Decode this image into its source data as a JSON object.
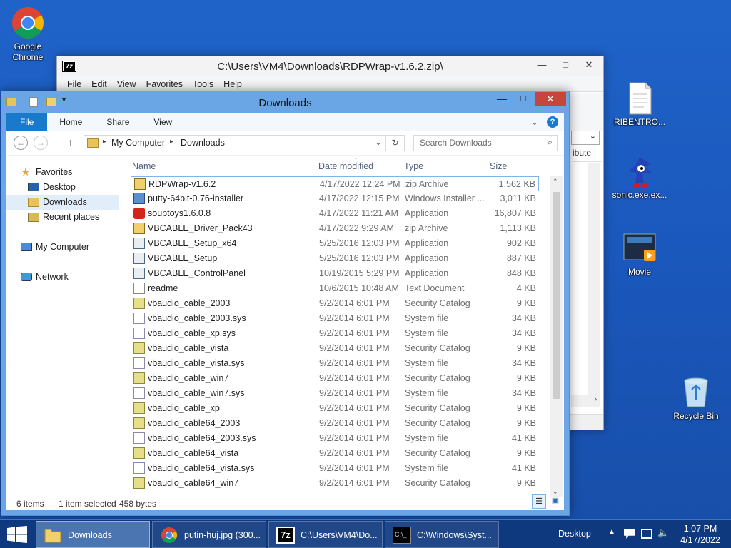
{
  "desktop": {
    "icons": [
      {
        "label": "Google\nChrome",
        "icon": "chrome-icon"
      },
      {
        "label": "RIBENTRO...",
        "icon": "document-icon"
      },
      {
        "label": "sonic.exe.ex...",
        "icon": "sonic-icon"
      },
      {
        "label": "Movie",
        "icon": "video-icon"
      },
      {
        "label": "Recycle Bin",
        "icon": "recycle-bin-icon"
      }
    ]
  },
  "sevenzip": {
    "title": "C:\\Users\\VM4\\Downloads\\RDPWrap-v1.6.2.zip\\",
    "badge": "7z",
    "menu": [
      "File",
      "Edit",
      "View",
      "Favorites",
      "Tools",
      "Help"
    ],
    "partial_column": "ibute"
  },
  "explorer": {
    "title": "Downloads",
    "ribbon_tabs": {
      "file": "File",
      "home": "Home",
      "share": "Share",
      "view": "View"
    },
    "breadcrumb": [
      "My Computer",
      "Downloads"
    ],
    "search_placeholder": "Search Downloads",
    "nav": {
      "favorites": "Favorites",
      "desktop": "Desktop",
      "downloads": "Downloads",
      "recent": "Recent places",
      "computer": "My Computer",
      "network": "Network"
    },
    "columns": {
      "name": "Name",
      "date": "Date modified",
      "type": "Type",
      "size": "Size"
    },
    "files": [
      {
        "name": "RDPWrap-v1.6.2",
        "date": "4/17/2022 12:24 PM",
        "type": "zip Archive",
        "size": "1,562 KB",
        "icon": "zip-icon"
      },
      {
        "name": "putty-64bit-0.76-installer",
        "date": "4/17/2022 12:15 PM",
        "type": "Windows Installer ...",
        "size": "3,011 KB",
        "icon": "installer-icon"
      },
      {
        "name": "souptoys1.6.0.8",
        "date": "4/17/2022 11:21 AM",
        "type": "Application",
        "size": "16,807 KB",
        "icon": "souptoys-icon"
      },
      {
        "name": "VBCABLE_Driver_Pack43",
        "date": "4/17/2022 9:29 AM",
        "type": "zip Archive",
        "size": "1,113 KB",
        "icon": "zip-icon"
      },
      {
        "name": "VBCABLE_Setup_x64",
        "date": "5/25/2016 12:03 PM",
        "type": "Application",
        "size": "902 KB",
        "icon": "app-icon"
      },
      {
        "name": "VBCABLE_Setup",
        "date": "5/25/2016 12:03 PM",
        "type": "Application",
        "size": "887 KB",
        "icon": "app-icon"
      },
      {
        "name": "VBCABLE_ControlPanel",
        "date": "10/19/2015 5:29 PM",
        "type": "Application",
        "size": "848 KB",
        "icon": "app-icon"
      },
      {
        "name": "readme",
        "date": "10/6/2015 10:48 AM",
        "type": "Text Document",
        "size": "4 KB",
        "icon": "text-icon"
      },
      {
        "name": "vbaudio_cable_2003",
        "date": "9/2/2014 6:01 PM",
        "type": "Security Catalog",
        "size": "9 KB",
        "icon": "catalog-icon"
      },
      {
        "name": "vbaudio_cable_2003.sys",
        "date": "9/2/2014 6:01 PM",
        "type": "System file",
        "size": "34 KB",
        "icon": "sys-icon"
      },
      {
        "name": "vbaudio_cable_xp.sys",
        "date": "9/2/2014 6:01 PM",
        "type": "System file",
        "size": "34 KB",
        "icon": "sys-icon"
      },
      {
        "name": "vbaudio_cable_vista",
        "date": "9/2/2014 6:01 PM",
        "type": "Security Catalog",
        "size": "9 KB",
        "icon": "catalog-icon"
      },
      {
        "name": "vbaudio_cable_vista.sys",
        "date": "9/2/2014 6:01 PM",
        "type": "System file",
        "size": "34 KB",
        "icon": "sys-icon"
      },
      {
        "name": "vbaudio_cable_win7",
        "date": "9/2/2014 6:01 PM",
        "type": "Security Catalog",
        "size": "9 KB",
        "icon": "catalog-icon"
      },
      {
        "name": "vbaudio_cable_win7.sys",
        "date": "9/2/2014 6:01 PM",
        "type": "System file",
        "size": "34 KB",
        "icon": "sys-icon"
      },
      {
        "name": "vbaudio_cable_xp",
        "date": "9/2/2014 6:01 PM",
        "type": "Security Catalog",
        "size": "9 KB",
        "icon": "catalog-icon"
      },
      {
        "name": "vbaudio_cable64_2003",
        "date": "9/2/2014 6:01 PM",
        "type": "Security Catalog",
        "size": "9 KB",
        "icon": "catalog-icon"
      },
      {
        "name": "vbaudio_cable64_2003.sys",
        "date": "9/2/2014 6:01 PM",
        "type": "System file",
        "size": "41 KB",
        "icon": "sys-icon"
      },
      {
        "name": "vbaudio_cable64_vista",
        "date": "9/2/2014 6:01 PM",
        "type": "Security Catalog",
        "size": "9 KB",
        "icon": "catalog-icon"
      },
      {
        "name": "vbaudio_cable64_vista.sys",
        "date": "9/2/2014 6:01 PM",
        "type": "System file",
        "size": "41 KB",
        "icon": "sys-icon"
      },
      {
        "name": "vbaudio_cable64_win7",
        "date": "9/2/2014 6:01 PM",
        "type": "Security Catalog",
        "size": "9 KB",
        "icon": "catalog-icon"
      }
    ],
    "status": {
      "items": "6 items",
      "selected": "1 item selected",
      "size": "458 bytes"
    }
  },
  "taskbar": {
    "buttons": [
      {
        "label": "Downloads",
        "icon": "folder-icon"
      },
      {
        "label": "putin-huj.jpg (300...",
        "icon": "chrome-icon"
      },
      {
        "label": "C:\\Users\\VM4\\Do...",
        "icon": "7zip-icon"
      },
      {
        "label": "C:\\Windows\\Syst...",
        "icon": "cmd-icon"
      }
    ],
    "desktop_label": "Desktop",
    "time": "1:07 PM",
    "date": "4/17/2022"
  }
}
